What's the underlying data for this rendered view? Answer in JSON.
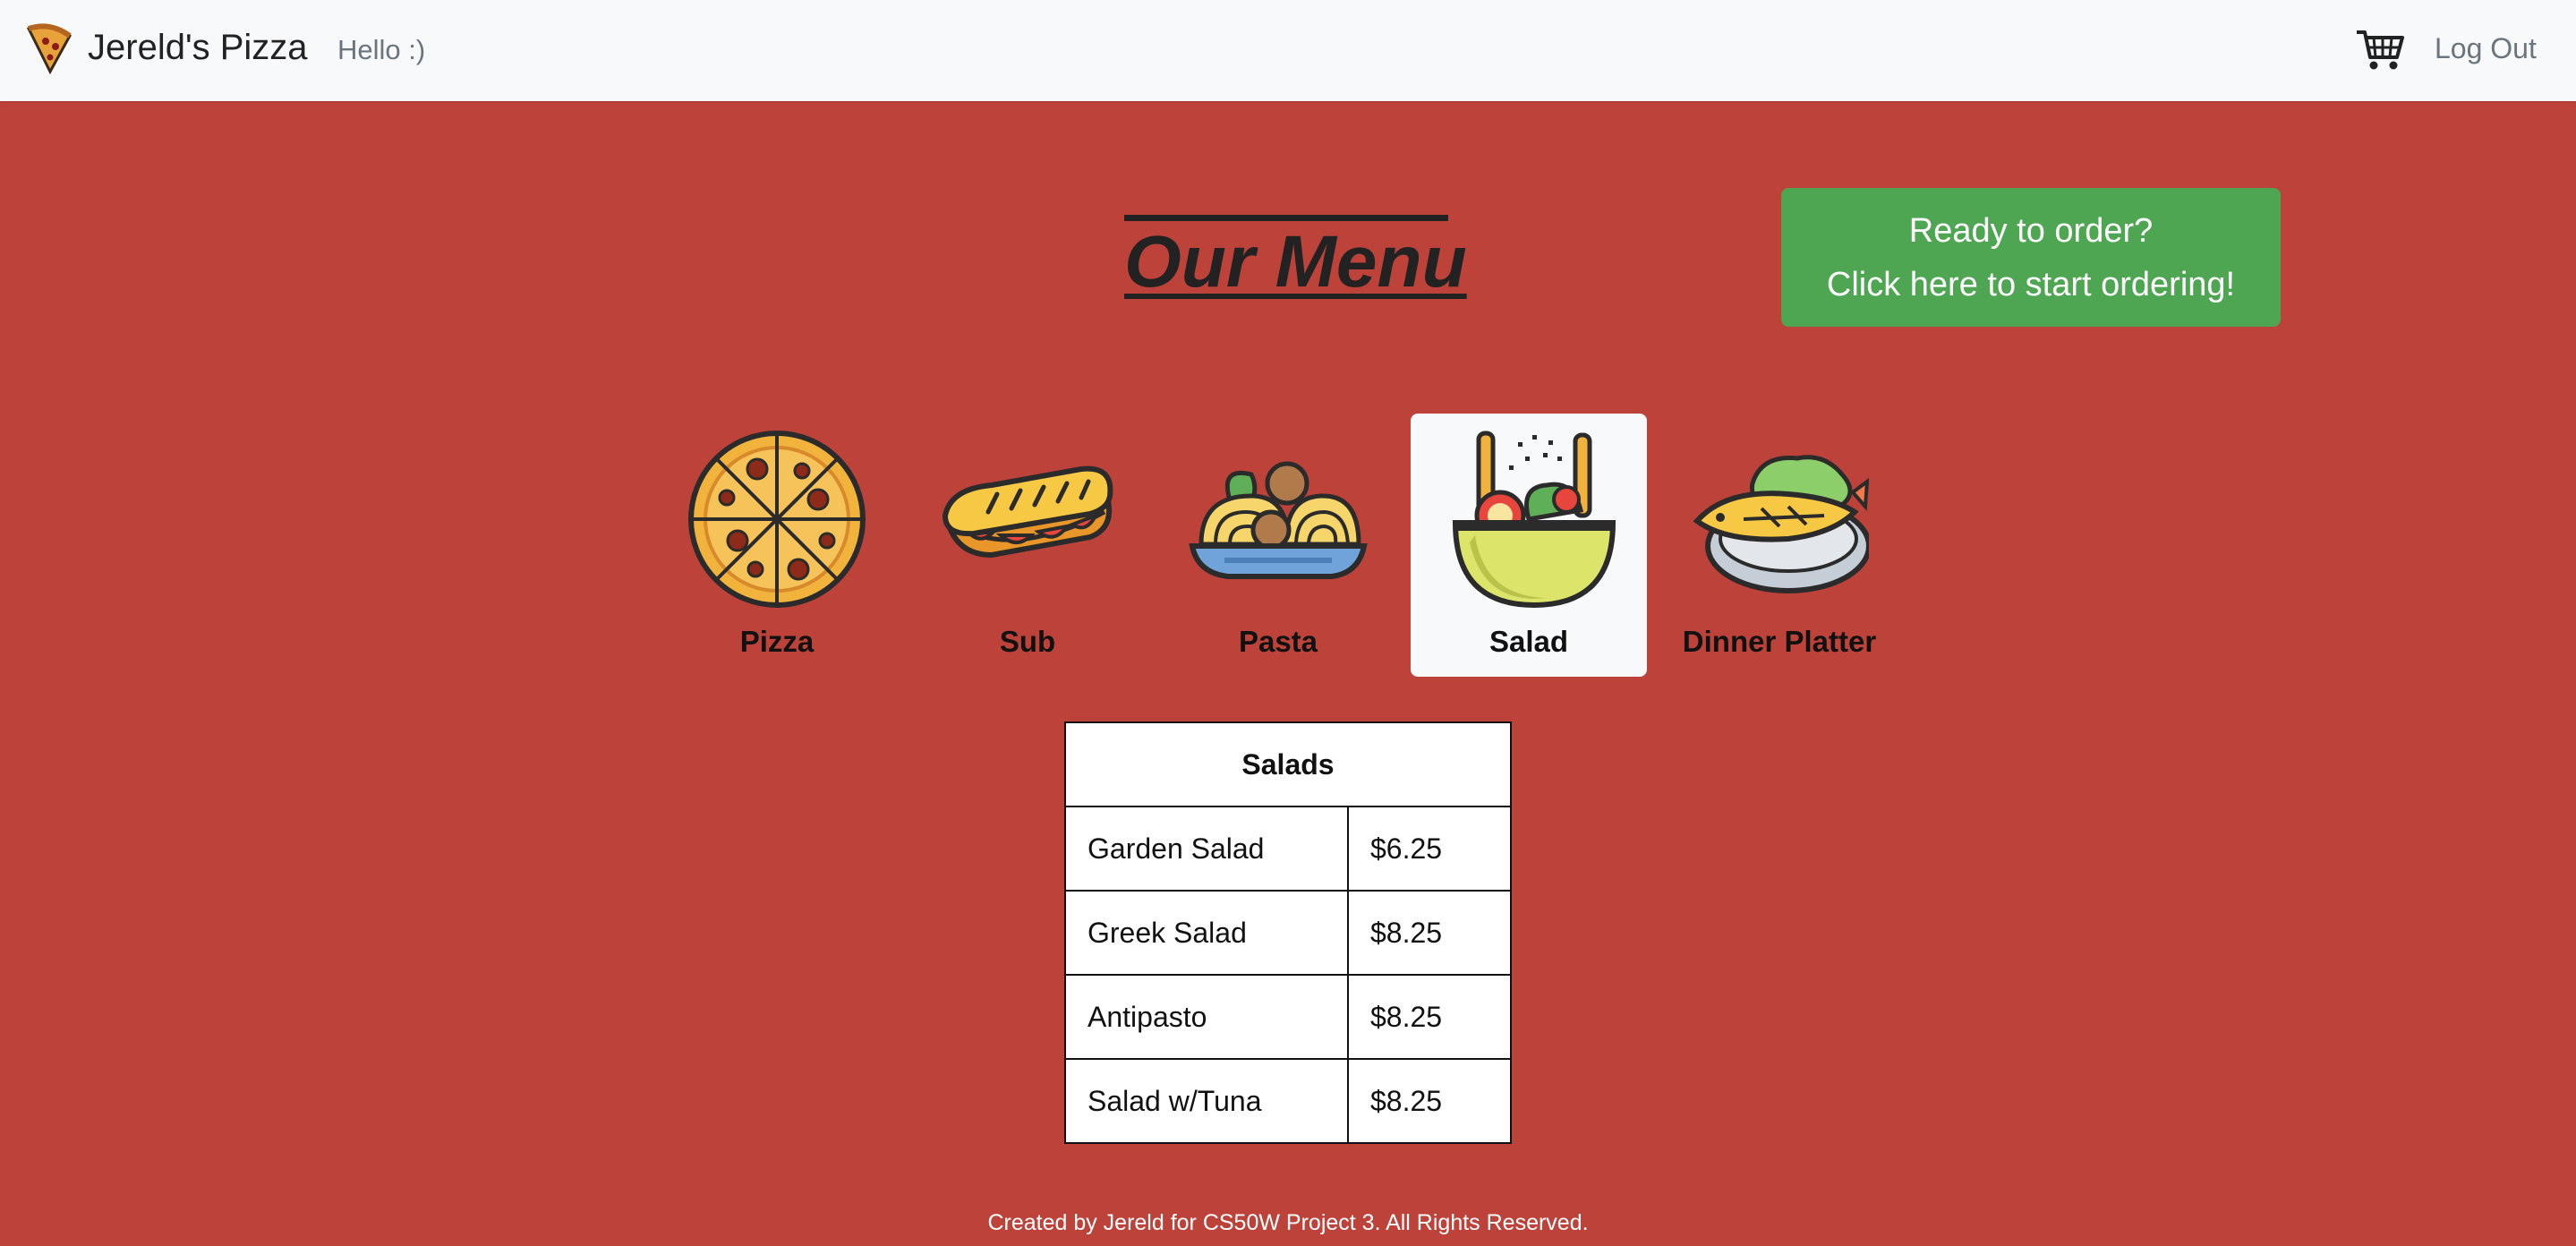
{
  "navbar": {
    "brand": "Jereld's Pizza",
    "greeting": "Hello :)",
    "logout": "Log Out",
    "brand_icon": "pizza-slice-icon",
    "cart_icon": "cart-icon"
  },
  "main": {
    "title": "Our Menu",
    "order_button": {
      "line1": "Ready to order?",
      "line2": "Click here to start ordering!"
    },
    "categories": [
      {
        "label": "Pizza",
        "icon": "pizza-icon"
      },
      {
        "label": "Sub",
        "icon": "sub-sandwich-icon"
      },
      {
        "label": "Pasta",
        "icon": "pasta-icon"
      },
      {
        "label": "Salad",
        "icon": "salad-icon",
        "selected": true
      },
      {
        "label": "Dinner Platter",
        "icon": "fish-platter-icon"
      }
    ],
    "table": {
      "header": "Salads",
      "rows": [
        {
          "name": "Garden Salad",
          "price": "$6.25"
        },
        {
          "name": "Greek Salad",
          "price": "$8.25"
        },
        {
          "name": "Antipasto",
          "price": "$8.25"
        },
        {
          "name": "Salad w/Tuna",
          "price": "$8.25"
        }
      ]
    }
  },
  "footer": {
    "text": "Created by Jereld for CS50W Project 3. All Rights Reserved."
  },
  "colors": {
    "background": "#bc423a",
    "navbar": "#f8f9fa",
    "order_button": "#4fa652"
  }
}
